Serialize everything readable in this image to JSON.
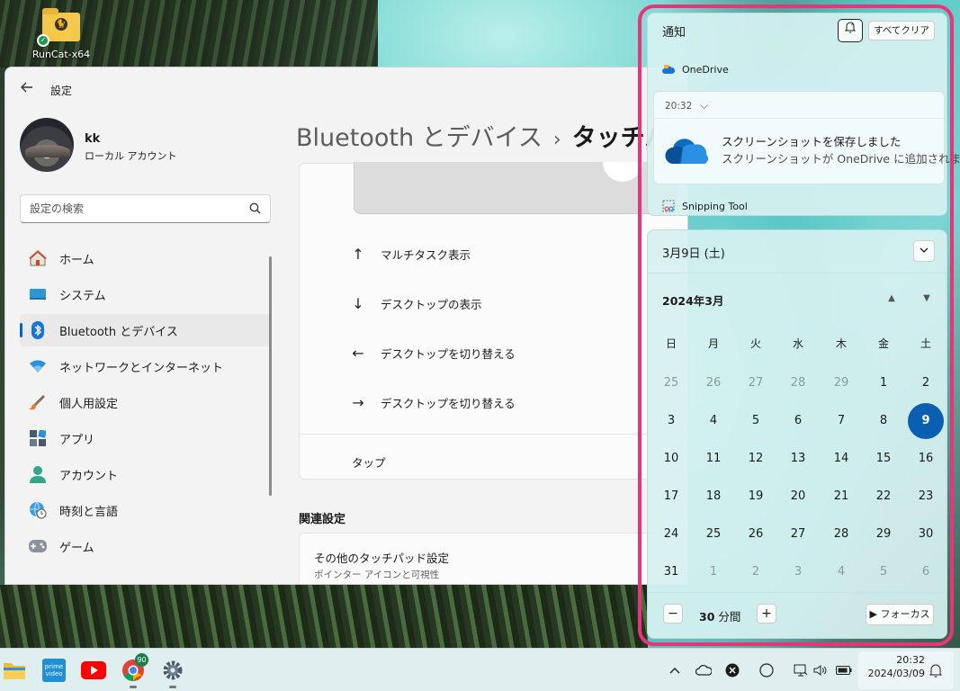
{
  "desktop": {
    "icon_label": "RunCat-x64"
  },
  "settings": {
    "app_title": "設定",
    "user": {
      "name": "kk",
      "account_type": "ローカル アカウント"
    },
    "search": {
      "placeholder": "設定の検索"
    },
    "nav": [
      {
        "label": "ホーム",
        "icon": "home-icon"
      },
      {
        "label": "システム",
        "icon": "system-icon"
      },
      {
        "label": "Bluetooth とデバイス",
        "icon": "bluetooth-icon",
        "active": true
      },
      {
        "label": "ネットワークとインターネット",
        "icon": "wifi-icon"
      },
      {
        "label": "個人用設定",
        "icon": "brush-icon"
      },
      {
        "label": "アプリ",
        "icon": "apps-icon"
      },
      {
        "label": "アカウント",
        "icon": "account-icon"
      },
      {
        "label": "時刻と言語",
        "icon": "globe-clock-icon"
      },
      {
        "label": "ゲーム",
        "icon": "gamepad-icon"
      }
    ],
    "breadcrumb": {
      "parent": "Bluetooth とデバイス",
      "separator": "›",
      "current": "タッチパッド"
    },
    "gestures": [
      {
        "arrow": "↑",
        "label": "マルチタスク表示"
      },
      {
        "arrow": "↓",
        "label": "デスクトップの表示"
      },
      {
        "arrow": "←",
        "label": "デスクトップを切り替える"
      },
      {
        "arrow": "→",
        "label": "デスクトップを切り替える"
      }
    ],
    "tap_label": "タップ",
    "related_title": "関連設定",
    "related_item": {
      "title": "その他のタッチパッド設定",
      "subtitle": "ポインター アイコンと可視性"
    }
  },
  "notifications": {
    "title": "通知",
    "clear_all": "すべてクリア",
    "groups": [
      {
        "app": "OneDrive"
      },
      {
        "app": "Snipping Tool"
      }
    ],
    "toast": {
      "time": "20:32",
      "title": "スクリーンショットを保存しました",
      "body": "スクリーンショットが OneDrive に追加されま"
    }
  },
  "calendar": {
    "date_header": "3月9日 (土)",
    "month": "2024年3月",
    "weekdays": [
      "日",
      "月",
      "火",
      "水",
      "木",
      "金",
      "土"
    ],
    "weeks": [
      [
        "25",
        "26",
        "27",
        "28",
        "29",
        "1",
        "2"
      ],
      [
        "3",
        "4",
        "5",
        "6",
        "7",
        "8",
        "9"
      ],
      [
        "10",
        "11",
        "12",
        "13",
        "14",
        "15",
        "16"
      ],
      [
        "17",
        "18",
        "19",
        "20",
        "21",
        "22",
        "23"
      ],
      [
        "24",
        "25",
        "26",
        "27",
        "28",
        "29",
        "30"
      ],
      [
        "31",
        "1",
        "2",
        "3",
        "4",
        "5",
        "6"
      ]
    ],
    "selected_day": "9",
    "focus": {
      "minutes": "30",
      "unit": "分間",
      "button": "フォーカス"
    }
  },
  "taskbar": {
    "chrome_badge": "90",
    "clock": {
      "time": "20:32",
      "date": "2024/03/09"
    }
  },
  "colors": {
    "accent": "#0a5fb0",
    "highlight": "#e8357a"
  }
}
